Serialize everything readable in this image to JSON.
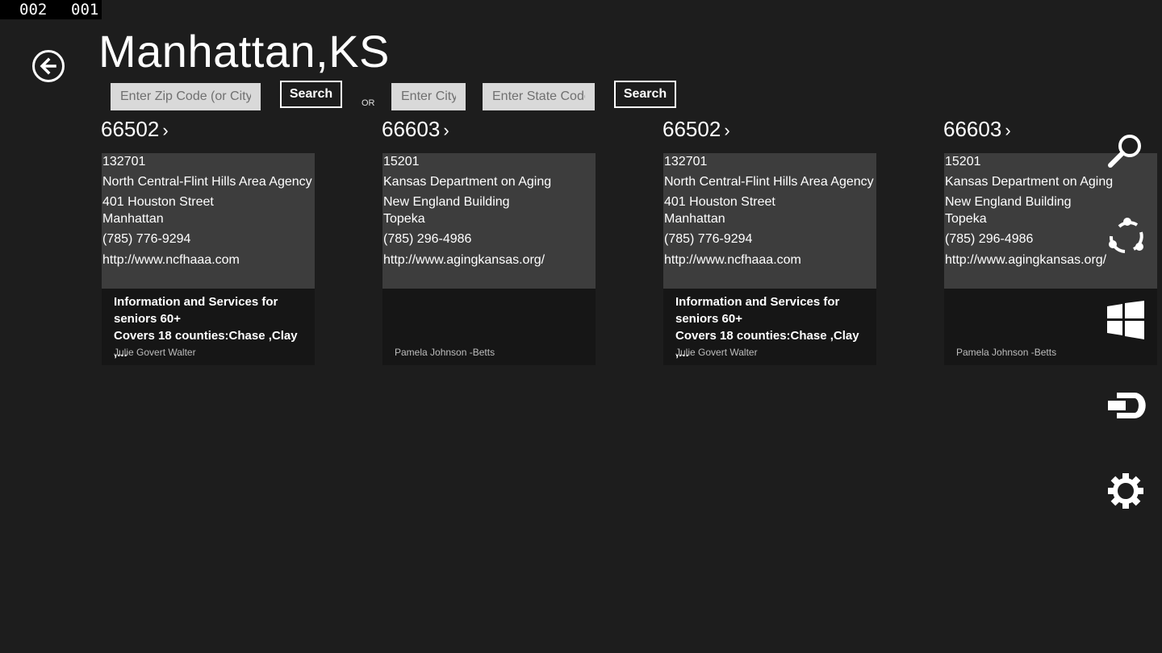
{
  "debug": {
    "left": "002",
    "right": "001"
  },
  "title": "Manhattan,KS",
  "search": {
    "zip_placeholder": "Enter Zip Code (or City)",
    "search_label_1": "Search",
    "or_label": "OR",
    "city_placeholder": "Enter City",
    "state_placeholder": "Enter State Code",
    "search_label_2": "Search"
  },
  "groups": [
    {
      "header": "66502",
      "card": {
        "id": "132701",
        "name": "North Central-Flint Hills Area Agency on Aging",
        "address": "401 Houston Street",
        "city": "Manhattan",
        "phone": "(785) 776-9294",
        "url": "http://www.ncfhaaa.com",
        "desc_line1": "Information and Services for",
        "desc_line2": "seniors 60+",
        "desc_line3": "Covers 18 counties:Chase ,Clay ,...",
        "person": "Julie Govert Walter"
      }
    },
    {
      "header": "66603",
      "card": {
        "id": "15201",
        "name": "Kansas Department on Aging",
        "address": "New England Building",
        "city": "Topeka",
        "phone": "(785) 296-4986",
        "url": "http://www.agingkansas.org/",
        "desc_line1": "",
        "desc_line2": "",
        "desc_line3": "",
        "person": "Pamela Johnson -Betts"
      }
    },
    {
      "header": "66502",
      "card": {
        "id": "132701",
        "name": "North Central-Flint Hills Area Agency on Aging",
        "address": "401 Houston Street",
        "city": "Manhattan",
        "phone": "(785) 776-9294",
        "url": "http://www.ncfhaaa.com",
        "desc_line1": "Information and Services for",
        "desc_line2": "seniors 60+",
        "desc_line3": "Covers 18 counties:Chase ,Clay ,...",
        "person": "Julie Govert Walter"
      }
    },
    {
      "header": "66603",
      "card": {
        "id": "15201",
        "name": "Kansas Department on Aging",
        "address": "New England Building",
        "city": "Topeka",
        "phone": "(785) 296-4986",
        "url": "http://www.agingkansas.org/",
        "desc_line1": "",
        "desc_line2": "",
        "desc_line3": "",
        "person": "Pamela Johnson -Betts"
      }
    }
  ],
  "charms": [
    "search-icon",
    "share-icon",
    "start-icon",
    "devices-icon",
    "settings-icon"
  ]
}
